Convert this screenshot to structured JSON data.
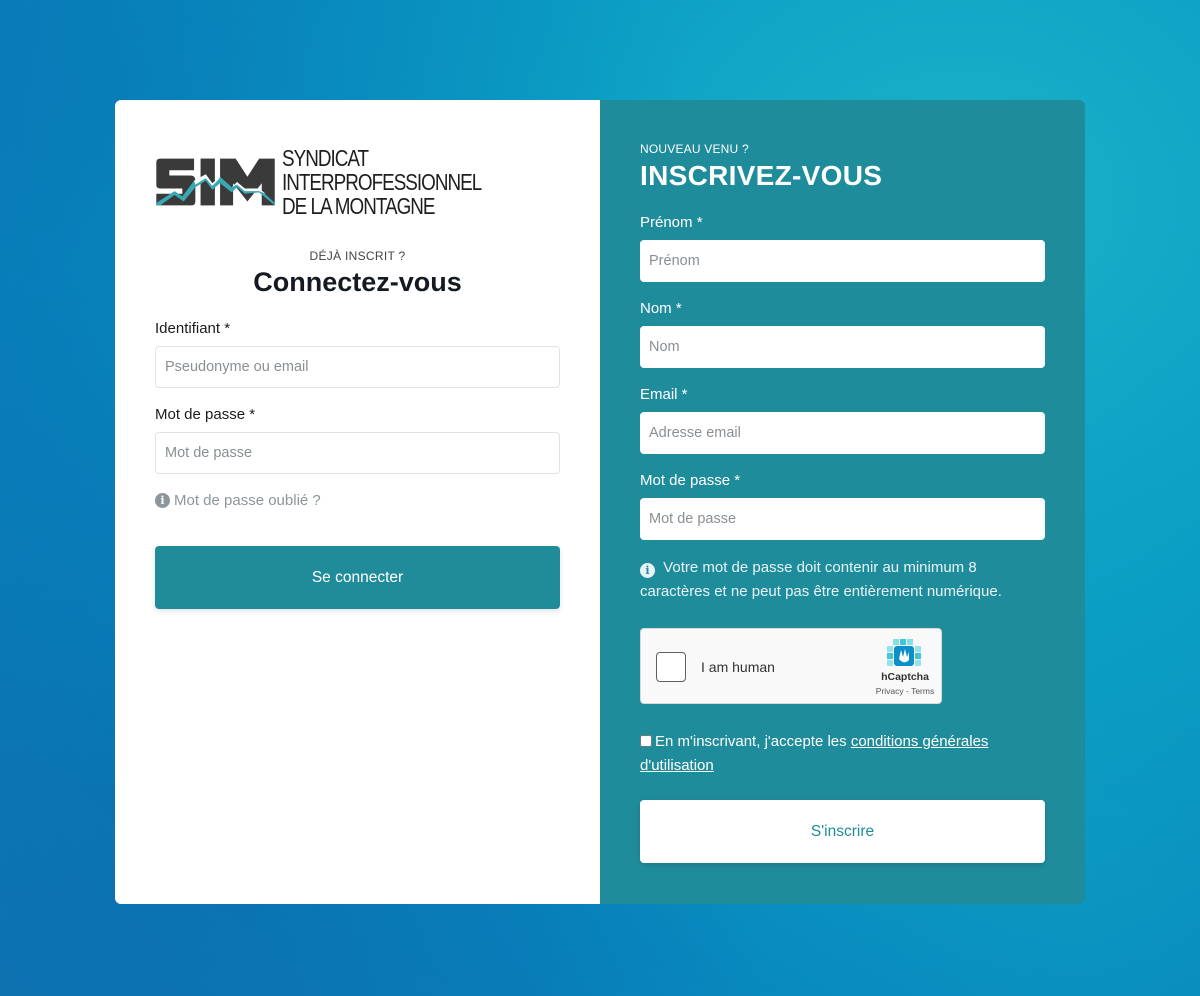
{
  "logo": {
    "mark": "SIM",
    "lines": [
      "SYNDICAT",
      "INTERPROFESSIONNEL",
      "DE LA MONTAGNE"
    ]
  },
  "login": {
    "eyebrow": "DÉJÀ INSCRIT ?",
    "title": "Connectez-vous",
    "id_label": "Identifiant *",
    "id_placeholder": "Pseudonyme ou email",
    "password_label": "Mot de passe *",
    "password_placeholder": "Mot de passe",
    "forgot": "Mot de passe oublié ?",
    "submit": "Se connecter"
  },
  "signup": {
    "eyebrow": "NOUVEAU VENU ?",
    "title": "INSCRIVEZ-VOUS",
    "firstname_label": "Prénom *",
    "firstname_placeholder": "Prénom",
    "lastname_label": "Nom *",
    "lastname_placeholder": "Nom",
    "email_label": "Email *",
    "email_placeholder": "Adresse email",
    "password_label": "Mot de passe *",
    "password_placeholder": "Mot de passe",
    "password_note": "Votre mot de passe doit contenir au minimum 8 caractères et ne peut pas être entièrement numérique.",
    "captcha": {
      "label": "I am human",
      "brand": "hCaptcha",
      "links": "Privacy - Terms"
    },
    "terms_prefix": "En m'inscrivant, j'accepte les ",
    "terms_link": "conditions générales d'utilisation",
    "submit": "S'inscrire"
  },
  "colors": {
    "teal": "#1f8c9c",
    "teal_button": "#218c99",
    "logo_dark": "#3a3a3a",
    "logo_accent": "#3aa7b5"
  }
}
